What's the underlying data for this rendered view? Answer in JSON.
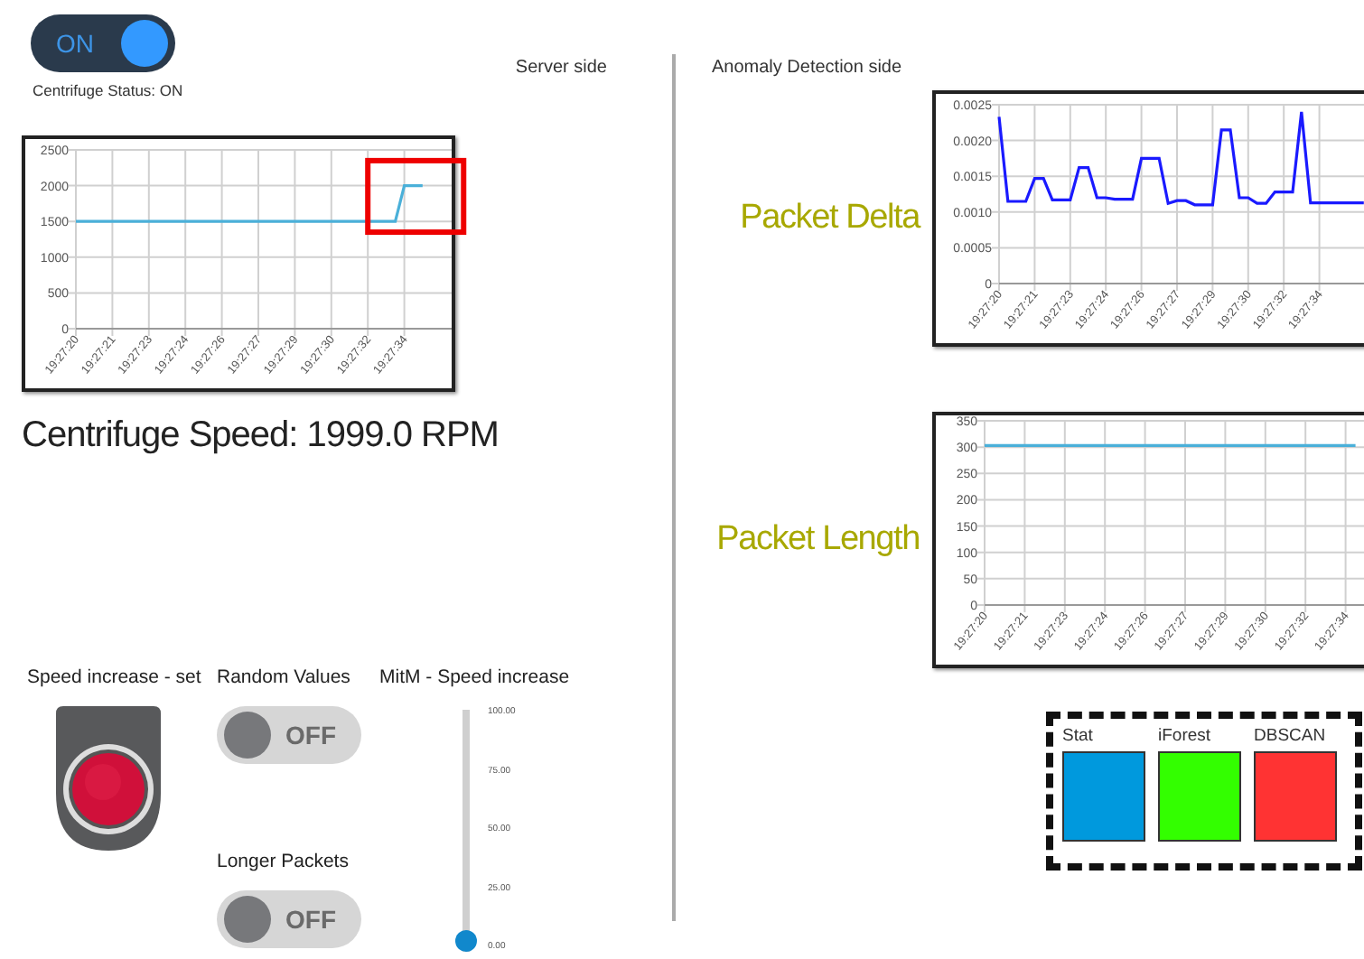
{
  "status_toggle": {
    "label": "ON",
    "on": true,
    "caption": "Centrifuge Status: ON"
  },
  "server_header": "Server side",
  "speed_chart": {
    "highlighted": true,
    "chart_data": {
      "type": "line",
      "categories": [
        "19:27:20",
        null,
        null,
        null,
        "19:27:21",
        null,
        null,
        null,
        "19:27:23",
        null,
        null,
        null,
        "19:27:24",
        null,
        null,
        null,
        "19:27:26",
        null,
        null,
        null,
        "19:27:27",
        null,
        null,
        null,
        "19:27:29",
        null,
        null,
        null,
        "19:27:30",
        null,
        null,
        null,
        "19:27:32",
        null,
        null,
        null,
        "19:27:34",
        null,
        null
      ],
      "series": [
        {
          "color": "#4ab0d9",
          "values": [
            1500,
            1500,
            1500,
            1500,
            1500,
            1500,
            1500,
            1500,
            1500,
            1500,
            1500,
            1500,
            1500,
            1500,
            1500,
            1500,
            1500,
            1500,
            1500,
            1500,
            1500,
            1500,
            1500,
            1500,
            1500,
            1500,
            1500,
            1500,
            1500,
            1500,
            1500,
            1500,
            1500,
            1500,
            1500,
            1500,
            2000,
            2000,
            2000
          ]
        }
      ],
      "grid": true,
      "ylim": [
        0,
        2500
      ],
      "yticks": [
        0,
        500,
        1000,
        1500,
        2000,
        2500
      ]
    }
  },
  "speed_readout": "Centrifuge Speed: 1999.0 RPM",
  "speed_button": {
    "label": "Speed increase - set"
  },
  "toggles": [
    {
      "label": "Random Values",
      "state_text": "OFF",
      "on": false
    },
    {
      "label": "Longer Packets",
      "state_text": "OFF",
      "on": false
    }
  ],
  "slider": {
    "label": "MitM - Speed increase",
    "level": 0,
    "ticks": [
      "100.00",
      "75.00",
      "50.00",
      "25.00",
      "0.00"
    ]
  },
  "anomaly_header": "Anomaly Detection side",
  "anomaly_charts": [
    {
      "label": "Packet Delta",
      "chart_data": {
        "type": "line",
        "categories": [
          "19:27:20",
          null,
          null,
          null,
          "19:27:21",
          null,
          null,
          null,
          "19:27:23",
          null,
          null,
          null,
          "19:27:24",
          null,
          null,
          null,
          "19:27:26",
          null,
          null,
          null,
          "19:27:27",
          null,
          null,
          null,
          "19:27:29",
          null,
          null,
          null,
          "19:27:30",
          null,
          null,
          null,
          "19:27:32",
          null,
          null,
          null,
          "19:27:34",
          null,
          null,
          null,
          null,
          null
        ],
        "series": [
          {
            "color": "#1a1aff",
            "values": [
              0.00233,
              0.00115,
              0.00115,
              0.00115,
              0.00147,
              0.00147,
              0.00117,
              0.00117,
              0.00117,
              0.00162,
              0.00162,
              0.0012,
              0.0012,
              0.00118,
              0.00118,
              0.00118,
              0.00175,
              0.00175,
              0.00175,
              0.00112,
              0.00116,
              0.00116,
              0.0011,
              0.0011,
              0.0011,
              0.00215,
              0.00215,
              0.0012,
              0.0012,
              0.00112,
              0.00112,
              0.00128,
              0.00128,
              0.00128,
              0.0024,
              0.00113,
              0.00113,
              0.00113,
              0.00113,
              0.00113,
              0.00113,
              0.00113
            ]
          }
        ],
        "grid": true,
        "ylim": [
          0,
          0.0025
        ],
        "yticks": [
          {
            "value": 0,
            "label": "0"
          },
          {
            "value": 0.0005,
            "label": "0.0005"
          },
          {
            "value": 0.001,
            "label": "0.0010"
          },
          {
            "value": 0.0015,
            "label": "0.0015"
          },
          {
            "value": 0.002,
            "label": "0.0020"
          },
          {
            "value": 0.0025,
            "label": "0.0025"
          }
        ]
      }
    },
    {
      "label": "Packet Length",
      "chart_data": {
        "type": "line",
        "categories": [
          "19:27:20",
          null,
          null,
          null,
          "19:27:21",
          null,
          null,
          null,
          "19:27:23",
          null,
          null,
          null,
          "19:27:24",
          null,
          null,
          null,
          "19:27:26",
          null,
          null,
          null,
          "19:27:27",
          null,
          null,
          null,
          "19:27:29",
          null,
          null,
          null,
          "19:27:30",
          null,
          null,
          null,
          "19:27:32",
          null,
          null,
          null,
          "19:27:34",
          null
        ],
        "series": [
          {
            "color": "#4ab0d9",
            "values": [
              303,
              303,
              303,
              303,
              303,
              303,
              303,
              303,
              303,
              303,
              303,
              303,
              303,
              303,
              303,
              303,
              303,
              303,
              303,
              303,
              303,
              303,
              303,
              303,
              303,
              303,
              303,
              303,
              303,
              303,
              303,
              303,
              303,
              303,
              303,
              303,
              303,
              303
            ]
          }
        ],
        "grid": true,
        "ylim": [
          0,
          350
        ],
        "yticks": [
          0,
          50,
          100,
          150,
          200,
          250,
          300,
          350
        ]
      }
    }
  ],
  "detectors": [
    {
      "name": "Stat",
      "color": "#0099dd"
    },
    {
      "name": "iForest",
      "color": "#33ff00"
    },
    {
      "name": "DBSCAN",
      "color": "#ff3333"
    }
  ]
}
